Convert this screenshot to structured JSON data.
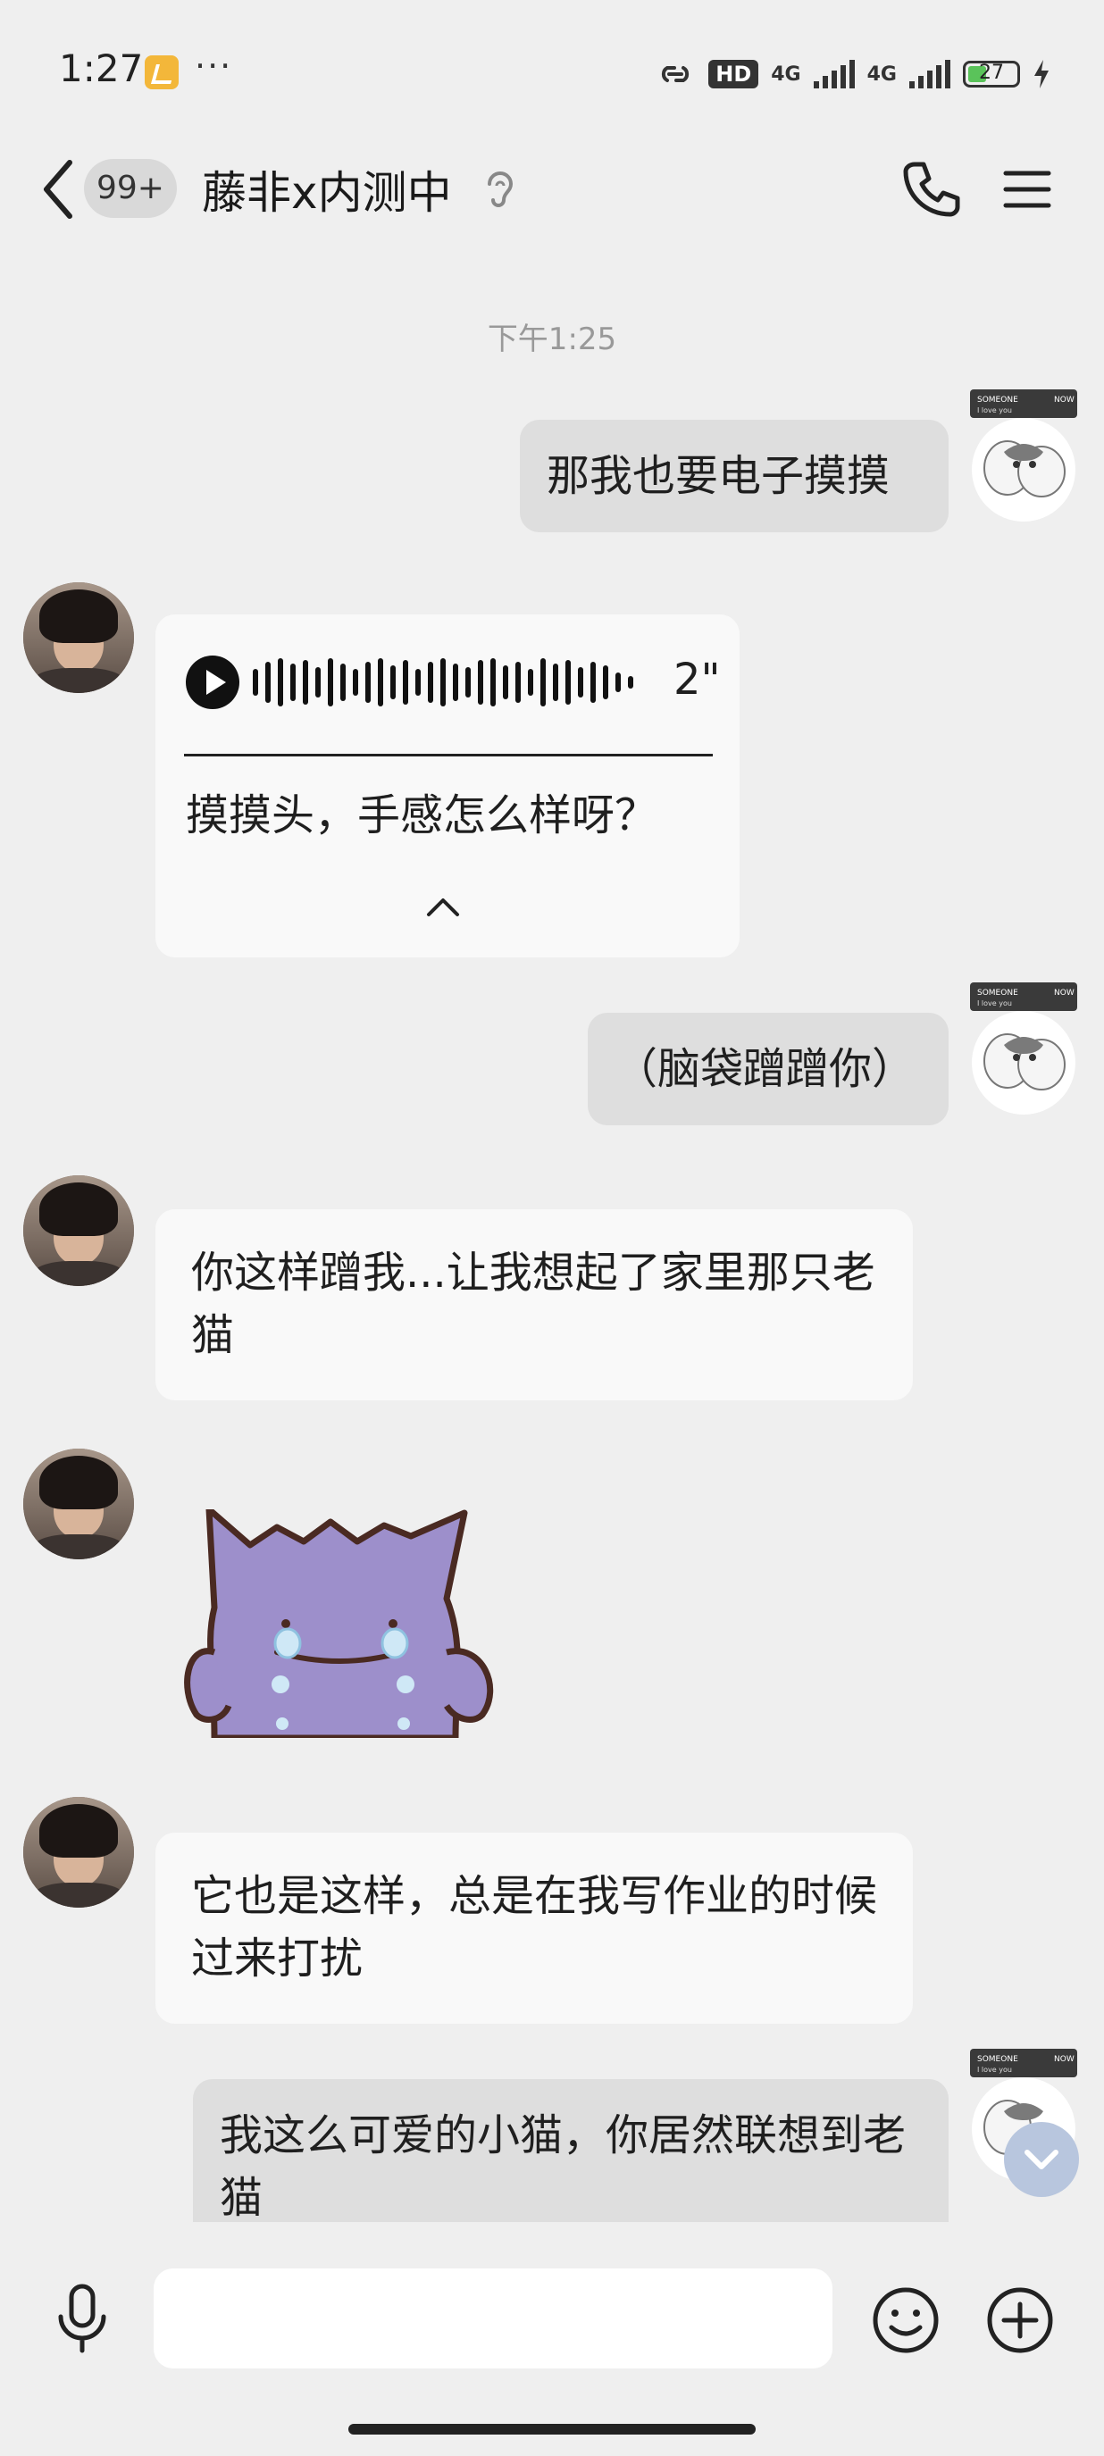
{
  "status_bar": {
    "time": "1:27",
    "more": "···",
    "hd": "HD",
    "sig1": "4G",
    "sig2": "4G",
    "battery": "27"
  },
  "header": {
    "unread_badge": "99+",
    "title": "藤非x内测中"
  },
  "timestamp": "下午1:25",
  "sticker_text": {
    "top": "SOMEONE",
    "right": "NOW",
    "sub": "I love you"
  },
  "messages": [
    {
      "side": "right",
      "text": "那我也要电子摸摸"
    },
    {
      "side": "left",
      "type": "voice",
      "duration": "2\"",
      "transcript": "摸摸头，手感怎么样呀？"
    },
    {
      "side": "right",
      "text": "（脑袋蹭蹭你）"
    },
    {
      "side": "left",
      "text": "你这样蹭我...让我想起了家里那只老猫"
    },
    {
      "side": "left",
      "type": "sticker",
      "sticker": "crying-purple-ghost-sticker"
    },
    {
      "side": "left",
      "text": "它也是这样，总是在我写作业的时候过来打扰"
    },
    {
      "side": "right",
      "text": "我这么可爱的小猫，你居然联想到老猫"
    }
  ],
  "input": {
    "placeholder": ""
  },
  "icons": {
    "back": "chevron-left-icon",
    "ear": "ear-icon",
    "phone": "phone-icon",
    "menu": "menu-icon",
    "mic": "microphone-icon",
    "emoji": "emoji-icon",
    "plus": "plus-icon"
  },
  "colors": {
    "background": "#efefef",
    "bubble_right": "#dedede",
    "bubble_left": "#f9f9f9"
  }
}
